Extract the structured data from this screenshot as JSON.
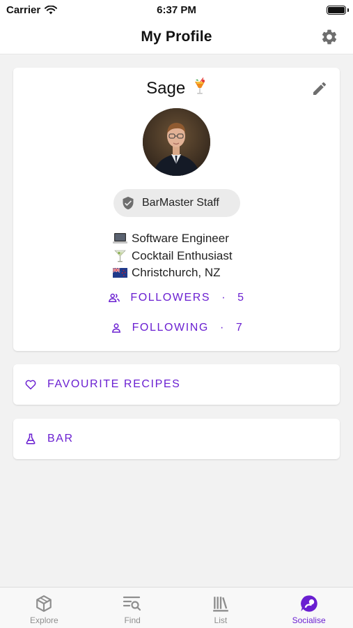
{
  "status_bar": {
    "carrier": "Carrier",
    "time": "6:37 PM"
  },
  "nav": {
    "title": "My Profile"
  },
  "profile": {
    "name": "Sage",
    "badge": "BarMaster Staff",
    "bio": [
      {
        "emoji": "laptop-emoji",
        "text": "Software Engineer"
      },
      {
        "emoji": "cocktail-glass-emoji",
        "text": "Cocktail Enthusiast"
      },
      {
        "emoji": "nz-flag-emoji",
        "text": "Christchurch, NZ"
      }
    ],
    "followers_label": "FOLLOWERS",
    "followers_count": "5",
    "following_label": "FOLLOWING",
    "following_count": "7",
    "separator": "·"
  },
  "menu": {
    "favourites_label": "FAVOURITE RECIPES",
    "bar_label": "BAR"
  },
  "tabs": [
    {
      "label": "Explore",
      "icon": "cube-icon"
    },
    {
      "label": "Find",
      "icon": "search-list-icon"
    },
    {
      "label": "List",
      "icon": "books-icon"
    },
    {
      "label": "Socialise",
      "icon": "chat-bubble-icon"
    }
  ],
  "colors": {
    "accent": "#6a1fd1",
    "inactive": "#8e8e8e",
    "background": "#f2f2f2"
  },
  "active_tab": "Socialise"
}
